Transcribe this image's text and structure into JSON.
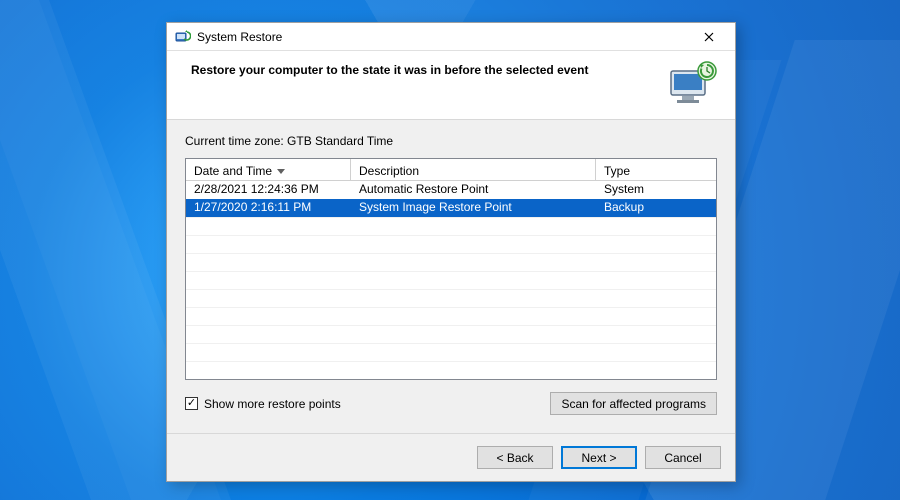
{
  "window": {
    "title": "System Restore"
  },
  "header": {
    "heading": "Restore your computer to the state it was in before the selected event"
  },
  "body": {
    "timezone_label": "Current time zone: GTB Standard Time",
    "columns": {
      "date_time": "Date and Time",
      "description": "Description",
      "type": "Type"
    },
    "rows": [
      {
        "date_time": "2/28/2021 12:24:36 PM",
        "description": "Automatic Restore Point",
        "type": "System",
        "selected": false
      },
      {
        "date_time": "1/27/2020 2:16:11 PM",
        "description": "System Image Restore Point",
        "type": "Backup",
        "selected": true
      }
    ],
    "show_more_label": "Show more restore points",
    "show_more_checked": true,
    "scan_button": "Scan for affected programs"
  },
  "footer": {
    "back": "< Back",
    "next": "Next >",
    "cancel": "Cancel"
  },
  "colors": {
    "selection": "#0a64c8",
    "accent": "#0078d7"
  }
}
